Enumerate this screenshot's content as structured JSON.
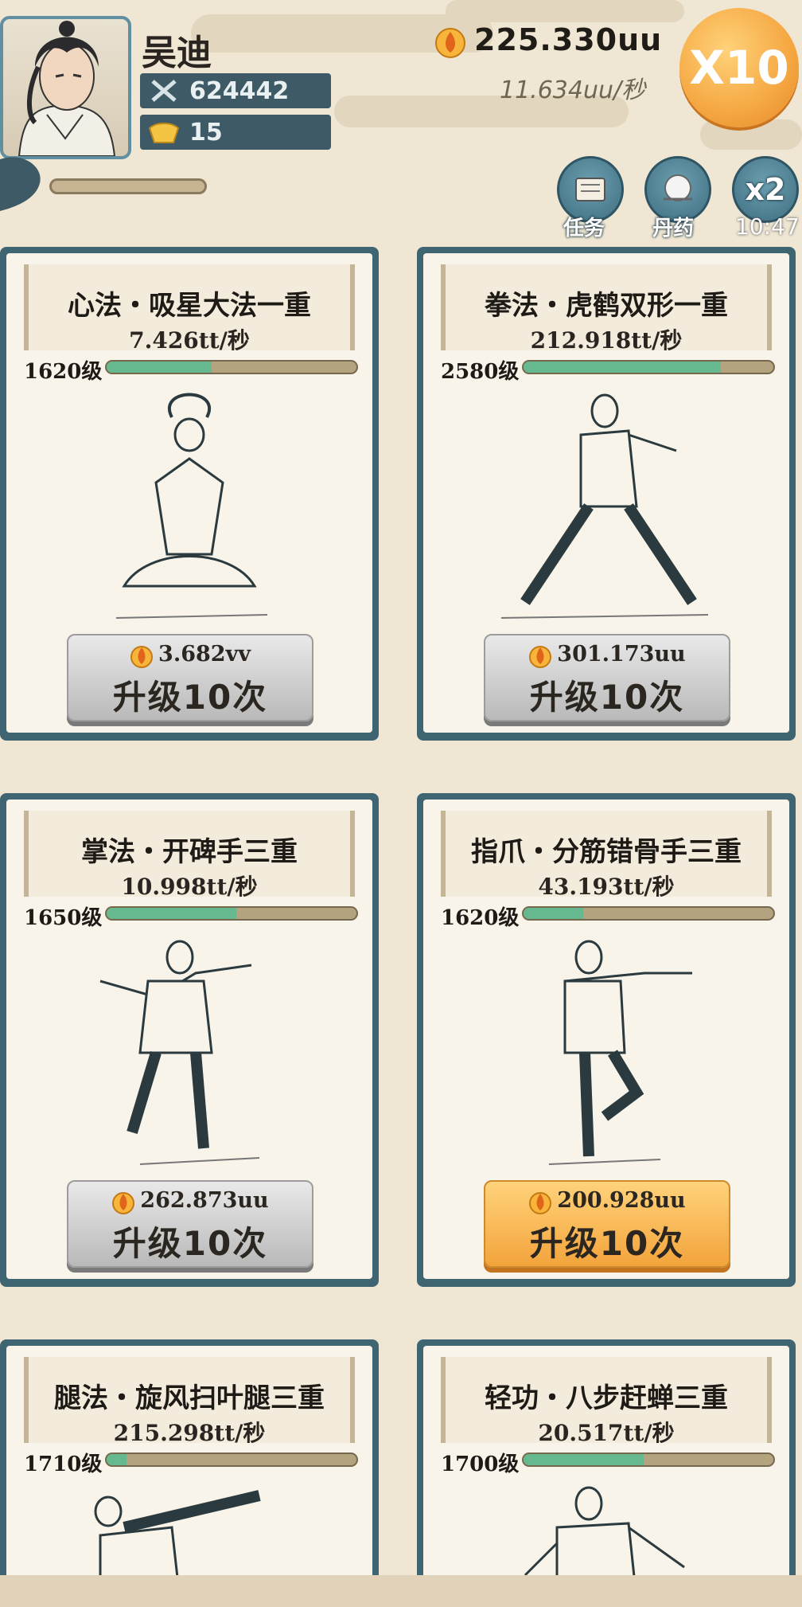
{
  "player": {
    "name": "吴迪",
    "power": "624442",
    "gold": "15"
  },
  "currency": {
    "total": "225.330uu",
    "rate": "11.634uu/秒"
  },
  "multiplier_button": "X10",
  "actions": [
    {
      "label": "任务",
      "icon": "scroll-icon"
    },
    {
      "label": "丹药",
      "icon": "pill-icon"
    },
    {
      "label": "x2",
      "icon": "double-icon"
    }
  ],
  "timer": "10:47",
  "cards": [
    {
      "title": "心法・吸星大法一重",
      "rate": "7.426tt/秒",
      "level": "1620级",
      "progress": 0.42,
      "cost": "3.682vv",
      "button": "升级10次",
      "active": false
    },
    {
      "title": "拳法・虎鹤双形一重",
      "rate": "212.918tt/秒",
      "level": "2580级",
      "progress": 0.79,
      "cost": "301.173uu",
      "button": "升级10次",
      "active": false
    },
    {
      "title": "掌法・开碑手三重",
      "rate": "10.998tt/秒",
      "level": "1650级",
      "progress": 0.52,
      "cost": "262.873uu",
      "button": "升级10次",
      "active": false
    },
    {
      "title": "指爪・分筋错骨手三重",
      "rate": "43.193tt/秒",
      "level": "1620级",
      "progress": 0.24,
      "cost": "200.928uu",
      "button": "升级10次",
      "active": true
    },
    {
      "title": "腿法・旋风扫叶腿三重",
      "rate": "215.298tt/秒",
      "level": "1710级",
      "progress": 0.08,
      "cost": "",
      "button": "",
      "active": false
    },
    {
      "title": "轻功・八步赶蝉三重",
      "rate": "20.517tt/秒",
      "level": "1700级",
      "progress": 0.48,
      "cost": "",
      "button": "",
      "active": false
    }
  ],
  "colors": {
    "accent": "#f5a741",
    "card": "#3f6472",
    "bar": "#66b88e"
  }
}
